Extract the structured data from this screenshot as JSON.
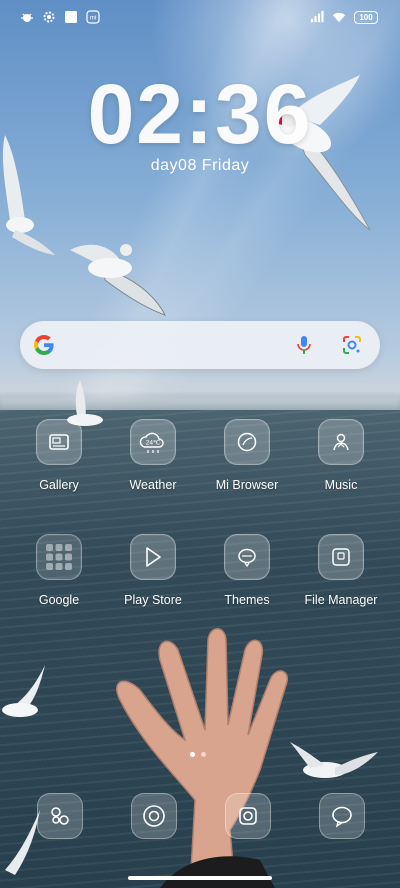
{
  "status_bar": {
    "left_icons": [
      "bug-icon",
      "settings-gear-icon",
      "square-icon",
      "mi-icon"
    ],
    "right_icons": [
      "signal-icon",
      "wifi-icon",
      "battery-icon"
    ],
    "battery_level": "100"
  },
  "clock": {
    "time": "02:36",
    "date": "day08  Friday"
  },
  "search_widget": {
    "icons": [
      "google-g-icon",
      "microphone-icon",
      "google-lens-icon"
    ]
  },
  "apps": [
    {
      "label": "Gallery",
      "icon": "gallery-icon"
    },
    {
      "label": "Weather",
      "icon": "weather-icon",
      "badge": "24℃"
    },
    {
      "label": "Mi Browser",
      "icon": "browser-icon"
    },
    {
      "label": "Music",
      "icon": "music-icon"
    },
    {
      "label": "Google",
      "icon": "google-folder-icon"
    },
    {
      "label": "Play Store",
      "icon": "play-store-icon"
    },
    {
      "label": "Themes",
      "icon": "themes-icon"
    },
    {
      "label": "File Manager",
      "icon": "file-manager-icon"
    }
  ],
  "page_indicator": {
    "pages": 2,
    "current": 1
  },
  "dock": [
    {
      "icon": "phone-dots-icon"
    },
    {
      "icon": "chrome-icon"
    },
    {
      "icon": "camera-icon"
    },
    {
      "icon": "messages-icon"
    }
  ]
}
